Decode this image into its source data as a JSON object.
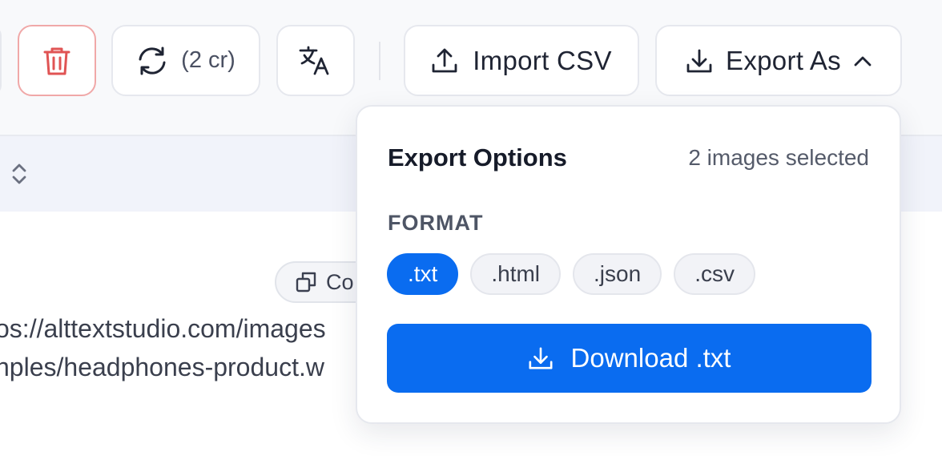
{
  "toolbar": {
    "regenerate_cost": "(2 cr)",
    "import_label": "Import CSV",
    "export_label": "Export As"
  },
  "table": {
    "header_fragment": ".",
    "copy_label": "Co",
    "url_line_1": "os://alttextstudio.com/images",
    "url_line_2": "nples/headphones-product.w"
  },
  "export_panel": {
    "title": "Export Options",
    "selection_count": "2 images selected",
    "format_label": "FORMAT",
    "formats": [
      ".txt",
      ".html",
      ".json",
      ".csv"
    ],
    "selected_format": ".txt",
    "download_label": "Download .txt"
  },
  "icons": {
    "delete": "trash-icon",
    "regenerate": "refresh-icon",
    "translate": "translate-icon",
    "import": "upload-icon",
    "export": "download-icon",
    "chevron": "chevron-up-icon",
    "copy": "copy-icon",
    "sort": "sort-icon"
  },
  "colors": {
    "accent": "#0a6cf0",
    "danger": "#e05454",
    "danger_border": "#f0a8a8"
  }
}
